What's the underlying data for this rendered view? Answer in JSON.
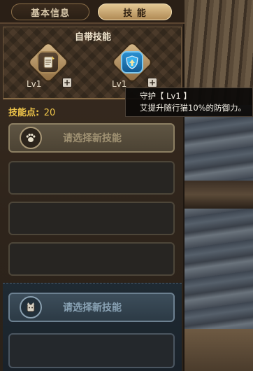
{
  "tabs": [
    {
      "label": "基本信息",
      "active": false
    },
    {
      "label": "技 能",
      "active": true
    }
  ],
  "innate": {
    "title": "自带技能",
    "skills": [
      {
        "level": "Lv1",
        "icon": "scroll-feather-icon",
        "accent": "#a98959"
      },
      {
        "level": "Lv1",
        "icon": "shield-arrow-icon",
        "accent": "#2a8fd0"
      }
    ]
  },
  "tooltip": {
    "line1": "守护【 Lv1 】",
    "line2": "艾提升随行猫10%的防御力。"
  },
  "skill_points": {
    "label": "技能点:",
    "value": "20"
  },
  "slots": {
    "select_label_1": "请选择新技能",
    "select_label_2": "请选择新技能",
    "select_icon_1": "paw-icon",
    "select_icon_2": "cat-helmet-icon"
  },
  "colors": {
    "points": "#f0c64a",
    "tab_active": "#d6b682"
  }
}
